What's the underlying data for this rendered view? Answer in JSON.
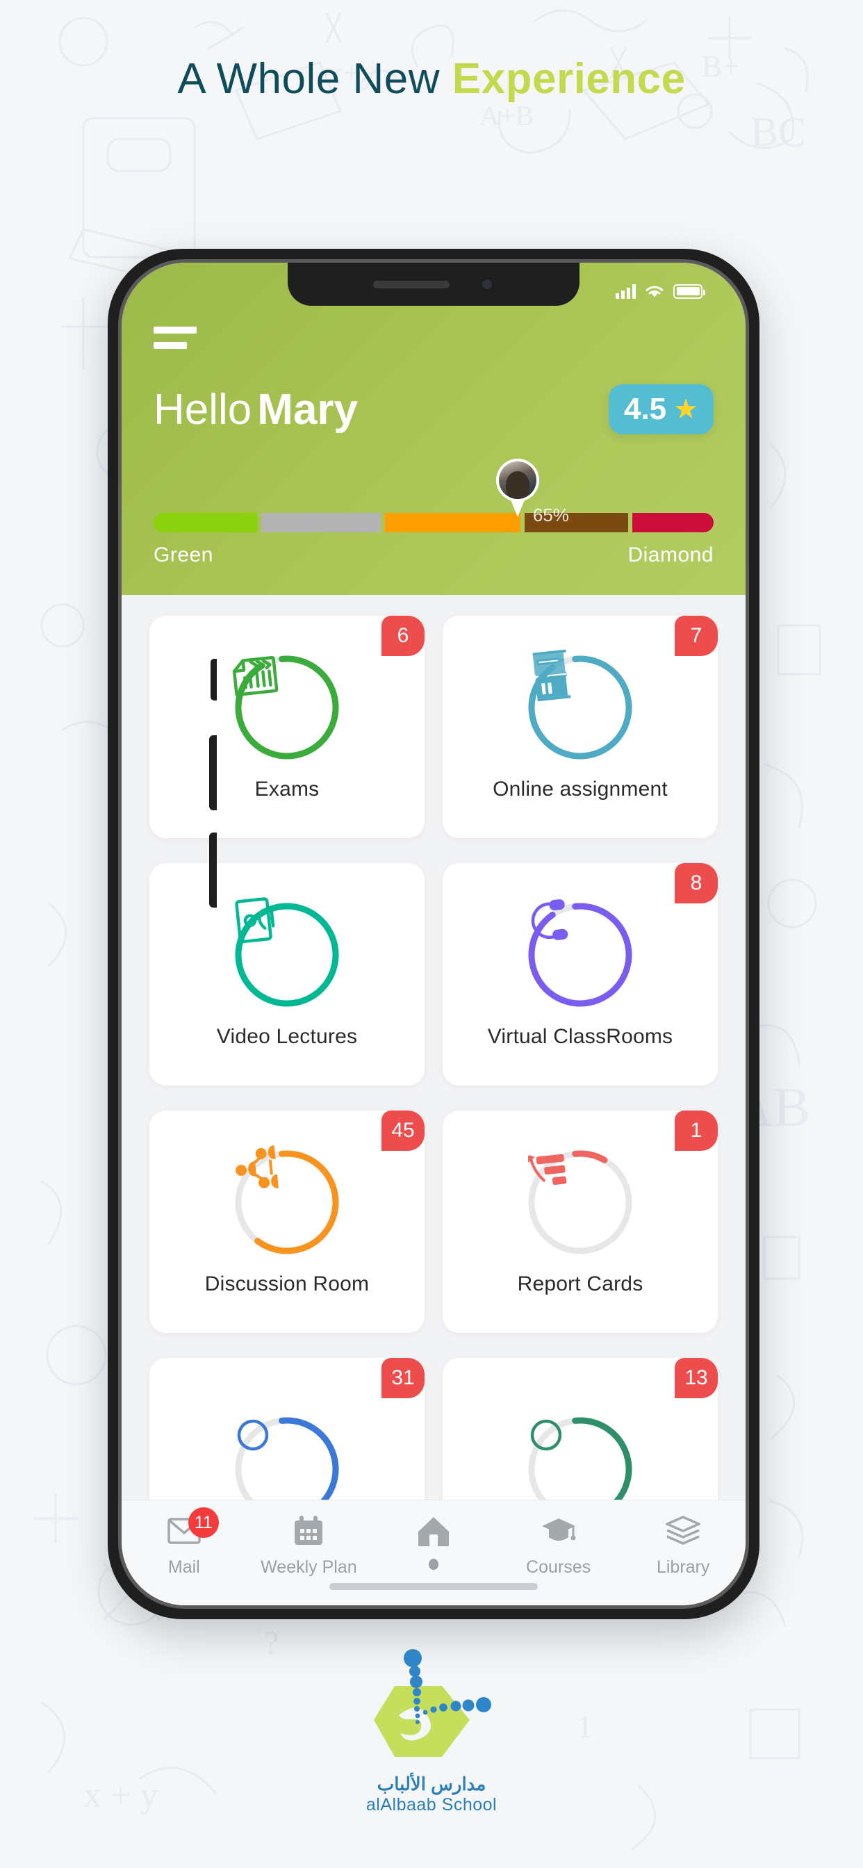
{
  "page": {
    "headline_thin": "A Whole New",
    "headline_bold": "Experience",
    "headline_thin_color": "#0f4c5c",
    "headline_bold_color": "#c5d94e",
    "background_color": "#f4f6f8"
  },
  "statusbar": {
    "signal_icon": "cellular-signal-icon",
    "wifi_icon": "wifi-icon",
    "battery_icon": "battery-full-icon"
  },
  "header": {
    "menu_icon": "hamburger-menu-icon",
    "greeting_prefix": "Hello",
    "user_name": "Mary",
    "rating_value": "4.5",
    "rating_star_icon": "star-icon",
    "rating_badge_color": "#55bdd2",
    "star_color": "#ffd527",
    "background_color": "#a9c453",
    "avatar_icon": "user-avatar-pin",
    "progress_percent_label": "65%",
    "progress_percent": 65,
    "tier_start_label": "Green",
    "tier_end_label": "Diamond",
    "progress_segments": [
      {
        "name": "green",
        "color": "#8cd10d",
        "width": 19
      },
      {
        "name": "silver",
        "color": "#b3b3b3",
        "width": 22
      },
      {
        "name": "gold",
        "color": "#ff9e00",
        "width": 25
      },
      {
        "name": "bronze",
        "color": "#7a4a10",
        "width": 19
      },
      {
        "name": "diamond",
        "color": "#cc0f3a",
        "width": 15
      }
    ]
  },
  "grid": {
    "cards": [
      {
        "label": "Exams",
        "badge": "6",
        "color": "#3bac3b",
        "progress": 93,
        "icon": "checklist-document-icon"
      },
      {
        "label": "Online assignment",
        "badge": "7",
        "color": "#4fabc4",
        "progress": 92,
        "icon": "book-pencil-icon"
      },
      {
        "label": "Video Lectures",
        "badge": "",
        "color": "#00b894",
        "progress": 100,
        "icon": "video-lecture-icon"
      },
      {
        "label": "Virtual ClassRooms",
        "badge": "8",
        "color": "#7a5cf0",
        "progress": 92,
        "icon": "headphones-icon"
      },
      {
        "label": "Discussion Room",
        "badge": "45",
        "color": "#f7931e",
        "progress": 62,
        "icon": "group-discussion-icon"
      },
      {
        "label": "Report Cards",
        "badge": "1",
        "color": "#f0655f",
        "progress": 10,
        "icon": "bar-chart-growth-icon"
      },
      {
        "label": "",
        "badge": "31",
        "color": "#3b78d8",
        "progress": 55,
        "icon": "partial-card-icon"
      },
      {
        "label": "",
        "badge": "13",
        "color": "#2f8f6b",
        "progress": 55,
        "icon": "partial-card-icon"
      }
    ]
  },
  "bottom_nav": {
    "items": [
      {
        "label": "Mail",
        "icon": "mail-icon",
        "badge": "11",
        "active": false
      },
      {
        "label": "Weekly Plan",
        "icon": "calendar-icon",
        "badge": "",
        "active": false
      },
      {
        "label": "",
        "icon": "home-icon",
        "badge": "",
        "active": true
      },
      {
        "label": "Courses",
        "icon": "graduation-cap-icon",
        "badge": "",
        "active": false
      },
      {
        "label": "Library",
        "icon": "books-stack-icon",
        "badge": "",
        "active": false
      }
    ]
  },
  "footer": {
    "logo_icon": "alalbaab-school-logo",
    "name_arabic": "مدارس الألباب",
    "name_english": "alAlbaab School",
    "logo_color": "#c5de5c",
    "logo_accent_color": "#2e86c8"
  }
}
